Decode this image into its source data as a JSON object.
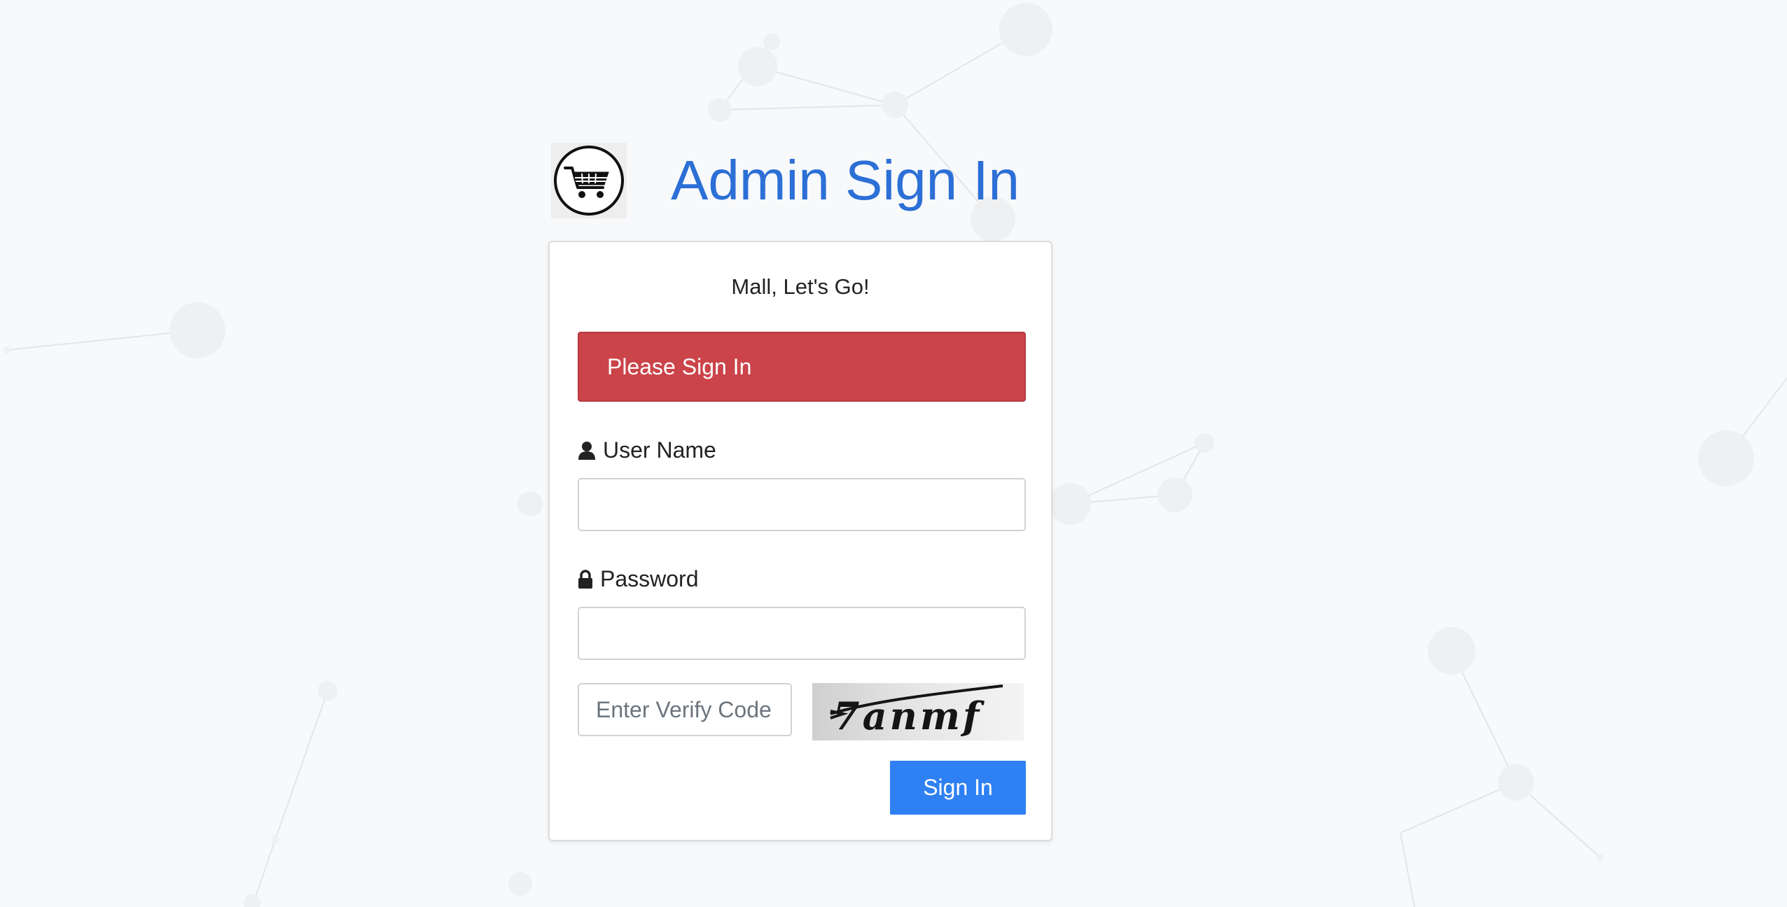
{
  "header": {
    "title": "Admin Sign In",
    "logo_icon": "shopping-cart-icon"
  },
  "card": {
    "tagline": "Mall, Let's Go!",
    "alert": "Please Sign In",
    "username": {
      "label": "User Name",
      "icon": "user-icon",
      "value": ""
    },
    "password": {
      "label": "Password",
      "icon": "lock-icon",
      "value": ""
    },
    "verify": {
      "placeholder": "Enter Verify Code",
      "captcha_text": "7anmf"
    },
    "submit_label": "Sign In"
  },
  "colors": {
    "title": "#2c6fd6",
    "alert_bg": "#cb444a",
    "button_bg": "#2f80f2",
    "page_bg": "#f8f9fb"
  }
}
